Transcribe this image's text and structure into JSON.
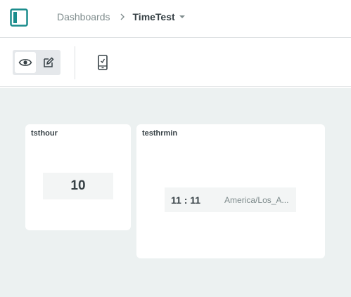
{
  "header": {
    "breadcrumb_root": "Dashboards",
    "dashboard_name": "TimeTest"
  },
  "toolbar": {
    "icons": [
      "eye-icon",
      "pencil-icon",
      "mobile-device-icon"
    ]
  },
  "widgets": [
    {
      "title": "tsthour",
      "value": "10"
    },
    {
      "title": "testhrmin",
      "time": "11 : 11",
      "timezone": "America/Los_A..."
    }
  ],
  "colors": {
    "accent": "#1a8c8c",
    "canvas_bg": "#ecf1f1",
    "text_primary": "#374146",
    "text_secondary": "#7f8c8d"
  }
}
